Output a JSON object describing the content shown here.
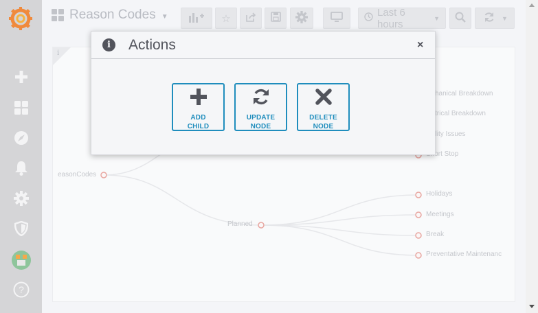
{
  "sidebar": {
    "items": [
      {
        "icon": "plus-icon"
      },
      {
        "icon": "dashboards-icon"
      },
      {
        "icon": "explore-icon"
      },
      {
        "icon": "bell-icon"
      },
      {
        "icon": "gear-icon"
      },
      {
        "icon": "shield-icon"
      },
      {
        "icon": "avatar"
      },
      {
        "icon": "help-icon"
      }
    ]
  },
  "header": {
    "dashboard_title": "Reason Codes",
    "time_range": "Last 6 hours"
  },
  "panel": {
    "info_glyph": "i"
  },
  "tree": {
    "root": "easonCodes",
    "branches": [
      {
        "label": "Planned"
      }
    ],
    "leaves": [
      {
        "label": "chanical Breakdown"
      },
      {
        "label": "ctrical Breakdown"
      },
      {
        "label": "ality Issues"
      },
      {
        "label": "Short Stop"
      },
      {
        "label": "Holidays"
      },
      {
        "label": "Meetings"
      },
      {
        "label": "Break"
      },
      {
        "label": "Preventative Maintenanc"
      }
    ]
  },
  "modal": {
    "title": "Actions",
    "close_glyph": "×",
    "info_glyph": "i",
    "actions": [
      {
        "line1": "ADD",
        "line2": "CHILD",
        "icon": "plus-icon"
      },
      {
        "line1": "UPDATE",
        "line2": "NODE",
        "icon": "refresh-icon"
      },
      {
        "line1": "DELETE",
        "line2": "NODE",
        "icon": "close-icon"
      }
    ]
  },
  "colors": {
    "accent": "#1f8dbd",
    "node_stroke": "#e8a6a0",
    "modal_text": "#52545c"
  }
}
